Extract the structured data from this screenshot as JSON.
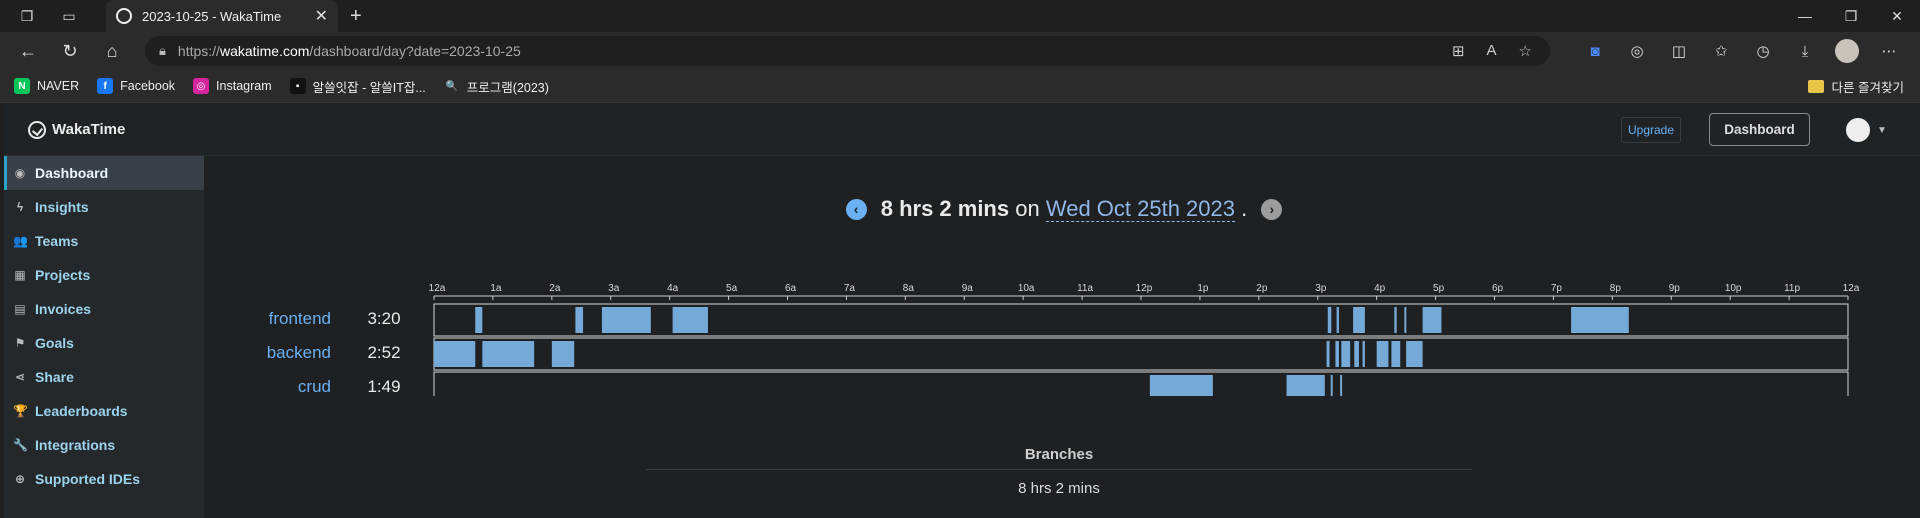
{
  "browser": {
    "tab_title": "2023-10-25 - WakaTime",
    "url": {
      "scheme": "https://",
      "host": "wakatime.com",
      "path": "/dashboard/day?date=2023-10-25"
    },
    "bookmarks": [
      {
        "label": "NAVER",
        "icon": "N",
        "color": "#03c75a"
      },
      {
        "label": "Facebook",
        "icon": "f",
        "color": "#1877f2"
      },
      {
        "label": "Instagram",
        "icon": "◎",
        "color": "#d6249f"
      },
      {
        "label": "알쓸잇잡 - 알쓸IT잡...",
        "icon": "▪",
        "color": "#111111"
      },
      {
        "label": "프로그램(2023)",
        "icon": "🔍",
        "color": "#2b2b2b"
      }
    ],
    "other_bookmarks": "다른 즐겨찾기"
  },
  "app": {
    "logo": "WakaTime",
    "upgrade": "Upgrade",
    "dashboard": "Dashboard"
  },
  "sidebar": {
    "items": [
      {
        "label": "Dashboard",
        "icon": "gauge-icon",
        "glyph": "◉",
        "active": true
      },
      {
        "label": "Insights",
        "icon": "bolt-icon",
        "glyph": "ϟ"
      },
      {
        "label": "Teams",
        "icon": "users-icon",
        "glyph": "👥"
      },
      {
        "label": "Projects",
        "icon": "grid-icon",
        "glyph": "▦"
      },
      {
        "label": "Invoices",
        "icon": "file-icon",
        "glyph": "▤"
      },
      {
        "label": "Goals",
        "icon": "flag-icon",
        "glyph": "⚑"
      },
      {
        "label": "Share",
        "icon": "share-icon",
        "glyph": "⋖"
      },
      {
        "label": "Leaderboards",
        "icon": "trophy-icon",
        "glyph": "🏆"
      },
      {
        "label": "Integrations",
        "icon": "wrench-icon",
        "glyph": "🔧"
      },
      {
        "label": "Supported IDEs",
        "icon": "plus-circle-icon",
        "glyph": "⊕"
      }
    ]
  },
  "day": {
    "duration": "8 hrs 2 mins",
    "on": "on",
    "date": "Wed Oct 25th 2023",
    "period": "."
  },
  "chart_data": {
    "type": "bar",
    "x_ticks": [
      "12a",
      "1a",
      "2a",
      "3a",
      "4a",
      "5a",
      "6a",
      "7a",
      "8a",
      "9a",
      "10a",
      "11a",
      "12p",
      "1p",
      "2p",
      "3p",
      "4p",
      "5p",
      "6p",
      "7p",
      "8p",
      "9p",
      "10p",
      "11p",
      "12a"
    ],
    "xlim": [
      0,
      24
    ],
    "bar_color": "#74a9d8",
    "series": [
      {
        "name": "frontend",
        "total": "3:20",
        "segments": [
          [
            0.7,
            0.82
          ],
          [
            2.4,
            2.53
          ],
          [
            2.85,
            3.68
          ],
          [
            4.05,
            4.65
          ],
          [
            15.17,
            15.23
          ],
          [
            15.32,
            15.36
          ],
          [
            15.6,
            15.8
          ],
          [
            16.3,
            16.34
          ],
          [
            16.47,
            16.5
          ],
          [
            16.78,
            17.1
          ],
          [
            19.3,
            20.28
          ]
        ]
      },
      {
        "name": "backend",
        "total": "2:52",
        "segments": [
          [
            0.0,
            0.7
          ],
          [
            0.82,
            1.7
          ],
          [
            2.0,
            2.38
          ],
          [
            15.15,
            15.2
          ],
          [
            15.3,
            15.36
          ],
          [
            15.4,
            15.55
          ],
          [
            15.62,
            15.7
          ],
          [
            15.76,
            15.8
          ],
          [
            16.0,
            16.2
          ],
          [
            16.25,
            16.4
          ],
          [
            16.5,
            16.78
          ]
        ]
      },
      {
        "name": "crud",
        "total": "1:49",
        "segments": [
          [
            12.15,
            13.22
          ],
          [
            14.47,
            15.12
          ],
          [
            15.22,
            15.25
          ],
          [
            15.38,
            15.41
          ]
        ]
      }
    ]
  },
  "branches": {
    "title": "Branches",
    "total": "8 hrs 2 mins"
  }
}
